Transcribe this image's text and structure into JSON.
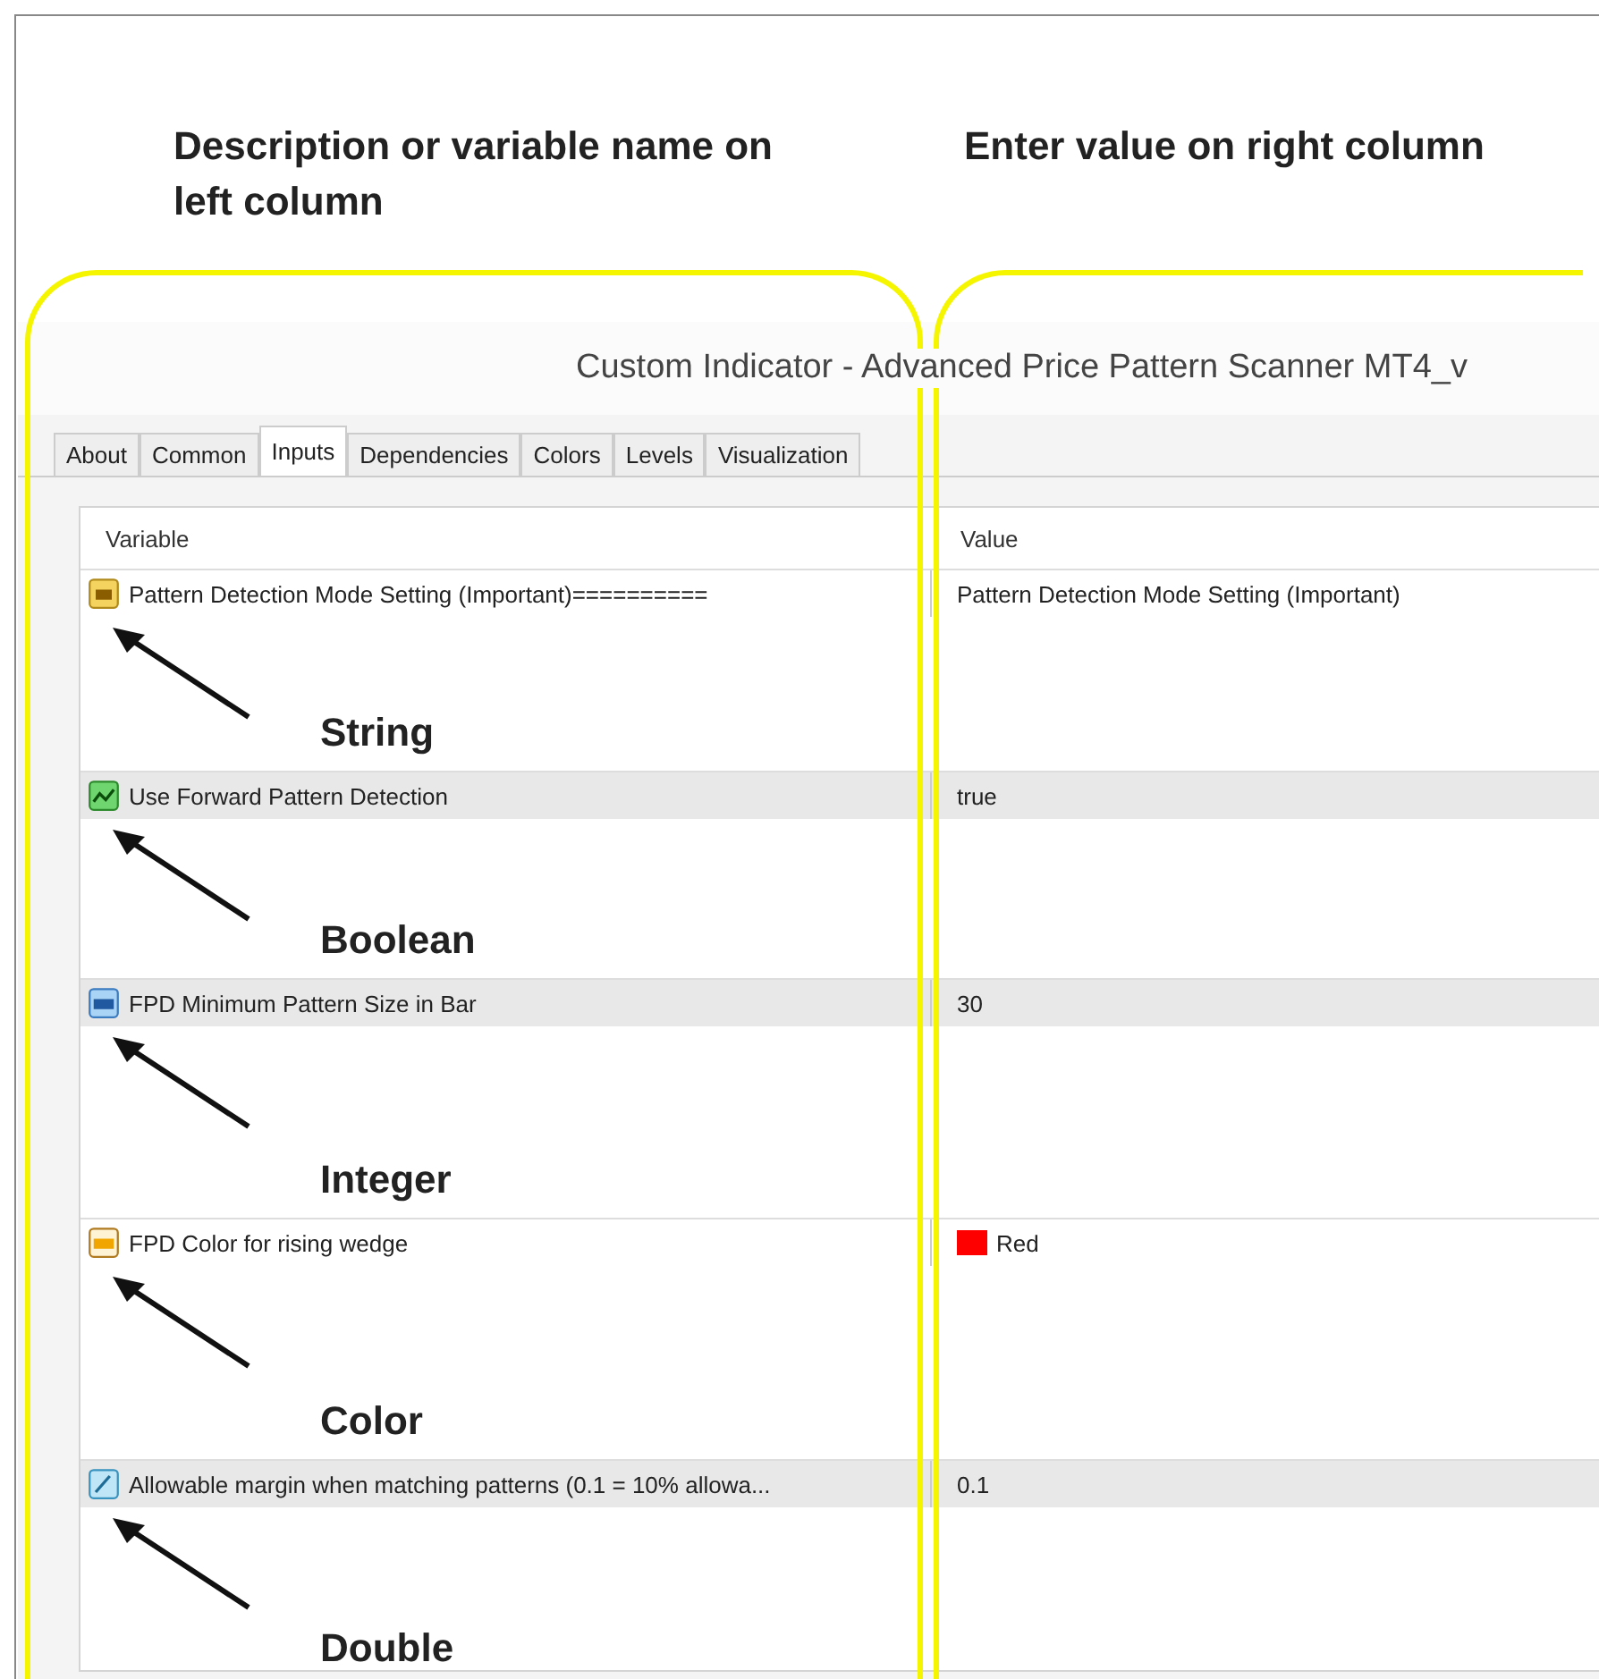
{
  "annotations": {
    "left_heading": "Description or variable name on left column",
    "right_heading": "Enter value on right column"
  },
  "window": {
    "title": "Custom Indicator - Advanced Price Pattern Scanner MT4_v"
  },
  "tabs": [
    {
      "label": "About",
      "selected": false
    },
    {
      "label": "Common",
      "selected": false
    },
    {
      "label": "Inputs",
      "selected": true
    },
    {
      "label": "Dependencies",
      "selected": false
    },
    {
      "label": "Colors",
      "selected": false
    },
    {
      "label": "Levels",
      "selected": false
    },
    {
      "label": "Visualization",
      "selected": false
    }
  ],
  "table": {
    "columns": [
      "Variable",
      "Value"
    ],
    "rows": [
      {
        "kind": "string",
        "variable": "Pattern Detection Mode Setting (Important)==========",
        "value": "Pattern Detection Mode Setting (Important)",
        "highlighted": false,
        "annotation": "String"
      },
      {
        "kind": "boolean",
        "variable": "Use Forward Pattern Detection",
        "value": "true",
        "highlighted": true,
        "annotation": "Boolean"
      },
      {
        "kind": "integer",
        "variable": "FPD Minimum Pattern Size in Bar",
        "value": "30",
        "highlighted": true,
        "annotation": "Integer"
      },
      {
        "kind": "color",
        "variable": "FPD Color for rising wedge",
        "value": "Red",
        "color": "#ff0000",
        "highlighted": false,
        "annotation": "Color"
      },
      {
        "kind": "double",
        "variable": "Allowable margin when matching patterns (0.1 = 10% allowa...",
        "value": "0.1",
        "highlighted": true,
        "annotation": "Double"
      }
    ]
  }
}
